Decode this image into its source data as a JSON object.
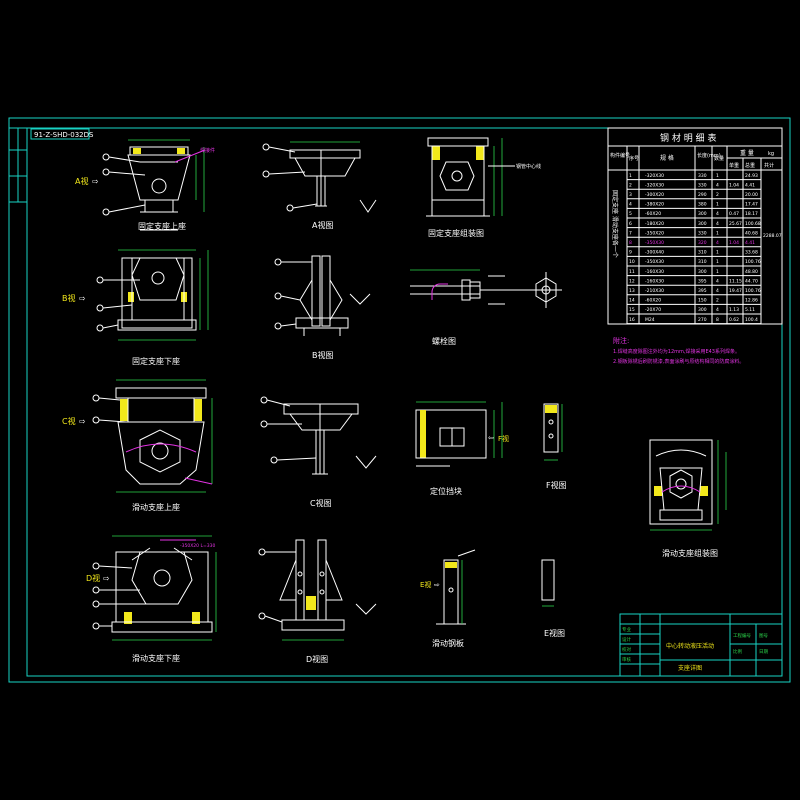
{
  "drawing_number": "91-Z-SHD-032DS",
  "views": {
    "fixed_upper": "固定支座上座",
    "fixed_lower": "固定支座下座",
    "sliding_upper": "滑动支座上座",
    "sliding_lower": "滑动支座下座",
    "a_view": "A视图",
    "b_view": "B视图",
    "c_view": "C视图",
    "d_view": "D视图",
    "fixed_assembly": "固定支座组装图",
    "bolt_view": "螺栓图",
    "limit_block": "定位挡块",
    "f_view": "F视图",
    "e_view": "E视图",
    "sliding_plate": "滑动钢板",
    "sliding_assembly": "滑动支座组装图"
  },
  "arrows": {
    "a": "A视",
    "b": "B视",
    "c": "C视",
    "d": "D视",
    "f": "F视",
    "e": "E视"
  },
  "material_table": {
    "title": "钢 材 明 细 表",
    "headers": {
      "part": "构件编号",
      "no": "序号",
      "spec": "规 格",
      "length": "长度(mm)",
      "qty": "数量",
      "weight": "重 量",
      "unit": "kg",
      "single": "单重",
      "total": "总重",
      "sum": "共计"
    },
    "group_label": "固定支座 滑动支座各一个",
    "grand_total": "2288.07",
    "rows": [
      {
        "no": "1",
        "spec": "-320X30",
        "len": "330",
        "qty": "1",
        "single": "",
        "total": "24.93",
        "highlight": false
      },
      {
        "no": "2",
        "spec": "-320X30",
        "len": "330",
        "qty": "4",
        "single": "1.04",
        "total": "4.41",
        "highlight": false
      },
      {
        "no": "3",
        "spec": "-300X20",
        "len": "290",
        "qty": "2",
        "single": "",
        "total": "20.00",
        "highlight": false
      },
      {
        "no": "4",
        "spec": "-380X20",
        "len": "380",
        "qty": "1",
        "single": "",
        "total": "17.47",
        "highlight": false
      },
      {
        "no": "5",
        "spec": "-60X20",
        "len": "300",
        "qty": "4",
        "single": "0.47",
        "total": "18.17",
        "highlight": false
      },
      {
        "no": "6",
        "spec": "-180X20",
        "len": "300",
        "qty": "4",
        "single": "25.67",
        "total": "100.68",
        "highlight": false
      },
      {
        "no": "7",
        "spec": "-350X20",
        "len": "330",
        "qty": "1",
        "single": "",
        "total": "40.68",
        "highlight": false
      },
      {
        "no": "8",
        "spec": "-350X30",
        "len": "320",
        "qty": "4",
        "single": "1.04",
        "total": "4.41",
        "highlight": true
      },
      {
        "no": "9",
        "spec": "-300X40",
        "len": "310",
        "qty": "1",
        "single": "",
        "total": "33.68",
        "highlight": false
      },
      {
        "no": "10",
        "spec": "-350X30",
        "len": "310",
        "qty": "1",
        "single": "",
        "total": "100.76",
        "highlight": false
      },
      {
        "no": "11",
        "spec": "-160X30",
        "len": "300",
        "qty": "1",
        "single": "",
        "total": "48.80",
        "highlight": false
      },
      {
        "no": "12",
        "spec": "-160X30",
        "len": "395",
        "qty": "4",
        "single": "11.15",
        "total": "44.70",
        "highlight": false
      },
      {
        "no": "13",
        "spec": "-210X30",
        "len": "395",
        "qty": "4",
        "single": "19.47",
        "total": "100.76",
        "highlight": false
      },
      {
        "no": "14",
        "spec": "-60X20",
        "len": "150",
        "qty": "2",
        "single": "",
        "total": "12.86",
        "highlight": false
      },
      {
        "no": "15",
        "spec": "-20X70",
        "len": "300",
        "qty": "4",
        "single": "1.13",
        "total": "5.11",
        "highlight": false
      },
      {
        "no": "16",
        "spec": "M24",
        "len": "270",
        "qty": "8",
        "single": "0.62",
        "total": "100.4",
        "highlight": false
      }
    ]
  },
  "notes": {
    "title": "附注:",
    "line1": "1.焊缝高度除图注外均为12mm,焊接采用E43系列焊条。",
    "line2": "2.钢板除锈后刷防锈漆,表面涂刷与原结构相同的防腐涂料。"
  },
  "title_block": {
    "project": "中心转动液压活动",
    "drawing_name": "支座详图",
    "cells": [
      "工程编号",
      "图号",
      "比例",
      "日期",
      "专业",
      "设计",
      "校对",
      "审核"
    ]
  },
  "colors": {
    "border": "#19d3c5",
    "line": "#ffffff",
    "accent": "#e233e2",
    "yellow": "#f2e81b",
    "dimension": "#2bd44b"
  }
}
